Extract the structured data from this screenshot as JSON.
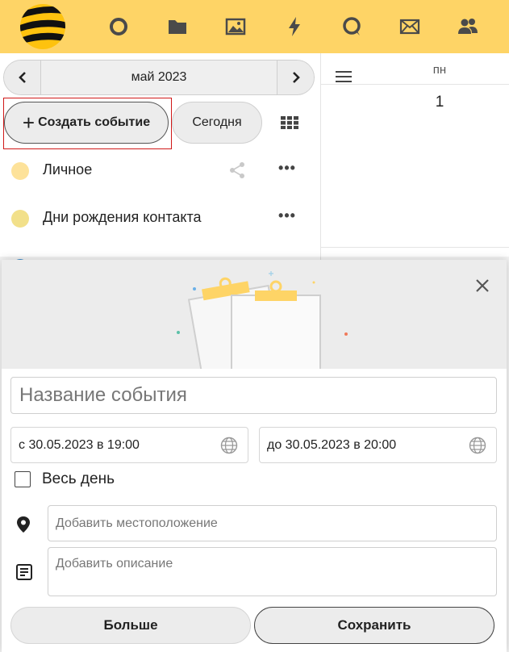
{
  "colors": {
    "accent": "#fed466",
    "highlight": "#d01919",
    "personal": "#fde29a",
    "birthdays": "#f2e08a",
    "third_calendar": "#3c8fd1"
  },
  "topnav": {
    "icons": [
      "beeline-logo-icon",
      "circle-icon",
      "folder-icon",
      "image-icon",
      "lightning-icon",
      "chat-icon",
      "mail-icon",
      "contacts-icon"
    ]
  },
  "calendar": {
    "month_label": "май 2023",
    "create_label": "Создать событие",
    "today_label": "Сегодня",
    "calendars": [
      {
        "name": "Личное",
        "color": "#fde29a"
      },
      {
        "name": "Дни рождения контакта",
        "color": "#f2e08a"
      }
    ],
    "weekday": "пн",
    "day": "1"
  },
  "event_form": {
    "title_placeholder": "Название события",
    "start_label": "с 30.05.2023 в 19:00",
    "end_label": "до 30.05.2023 в 20:00",
    "all_day_label": "Весь день",
    "location_placeholder": "Добавить местоположение",
    "description_placeholder": "Добавить описание",
    "more_label": "Больше",
    "save_label": "Сохранить"
  }
}
